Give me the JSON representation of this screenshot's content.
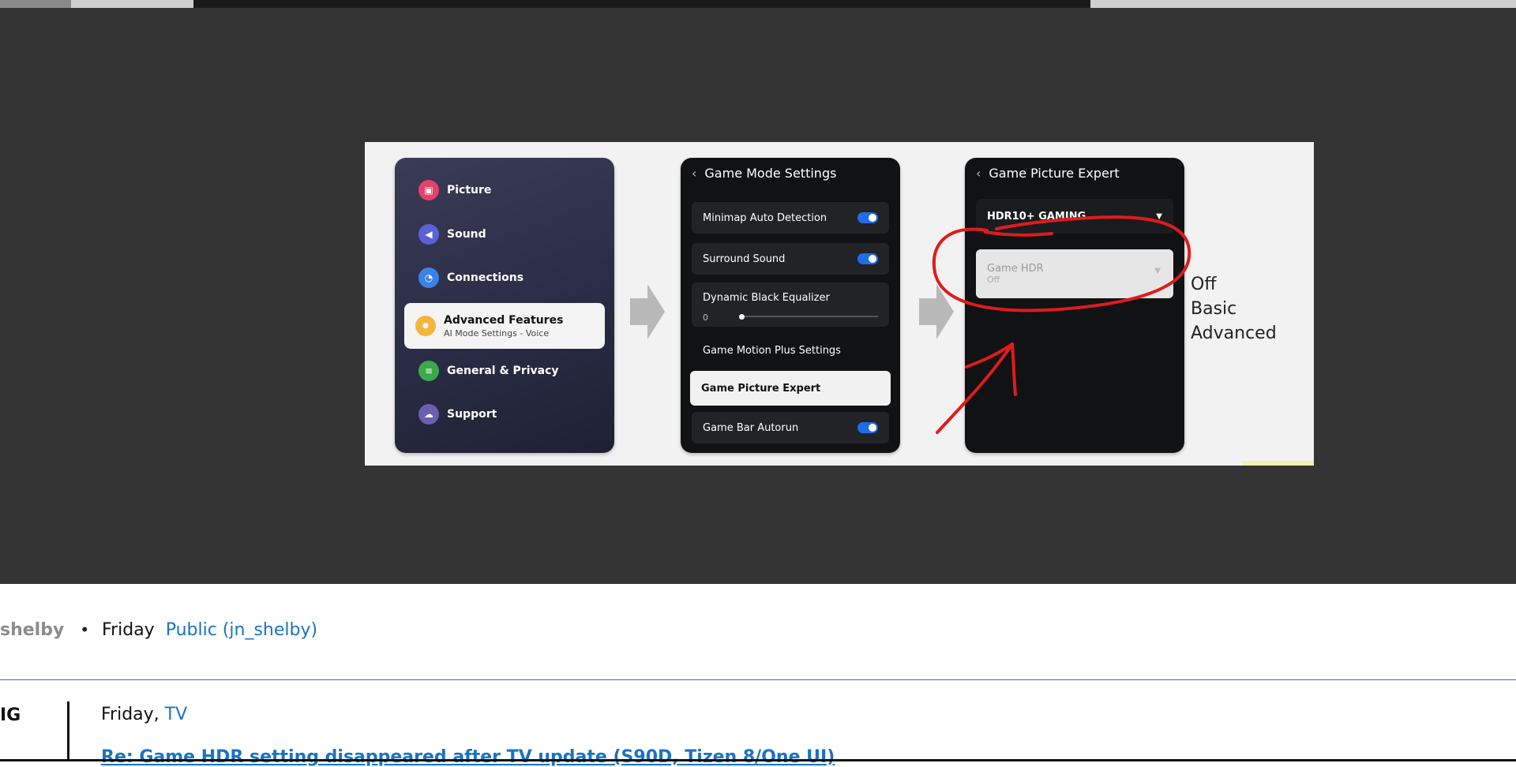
{
  "image_panel": {
    "menu": {
      "items": [
        {
          "label": "Picture",
          "icon": "picture-icon",
          "color": "#e3436b"
        },
        {
          "label": "Sound",
          "icon": "sound-icon",
          "color": "#5a62d9"
        },
        {
          "label": "Connections",
          "icon": "wifi-icon",
          "color": "#3b82e6"
        },
        {
          "label": "Advanced Features",
          "sub": "AI Mode Settings - Voice",
          "icon": "gear-icon",
          "color": "#f4b53f",
          "active": true
        },
        {
          "label": "General & Privacy",
          "icon": "toggle-settings-icon",
          "color": "#3aaa4a"
        },
        {
          "label": "Support",
          "icon": "cloud-icon",
          "color": "#6a5fae"
        }
      ]
    },
    "game_mode": {
      "title": "Game Mode Settings",
      "rows": [
        {
          "label": "Minimap Auto Detection",
          "toggle": true
        },
        {
          "label": "Surround Sound",
          "toggle": true
        },
        {
          "label": "Dynamic Black Equalizer",
          "value": "0"
        },
        {
          "label": "Game Motion Plus Settings"
        },
        {
          "label": "Game Picture Expert",
          "highlight": true
        },
        {
          "label": "Game Bar Autorun",
          "toggle": true
        }
      ]
    },
    "picture_expert": {
      "title": "Game Picture Expert",
      "hdr_mode": "HDR10+ GAMING",
      "game_hdr_label": "Game HDR",
      "game_hdr_value": "Off"
    },
    "options": [
      "Off",
      "Basic",
      "Advanced"
    ],
    "annotation_color": "#e01b1b"
  },
  "post": {
    "author": "shelby",
    "date": "Friday",
    "visibility": "Public (jn_shelby)"
  },
  "reply": {
    "author_tail": "IG",
    "date": "Friday,",
    "category": "TV",
    "title": "Re: Game HDR setting disappeared after TV update (S90D, Tizen 8/One UI)"
  }
}
